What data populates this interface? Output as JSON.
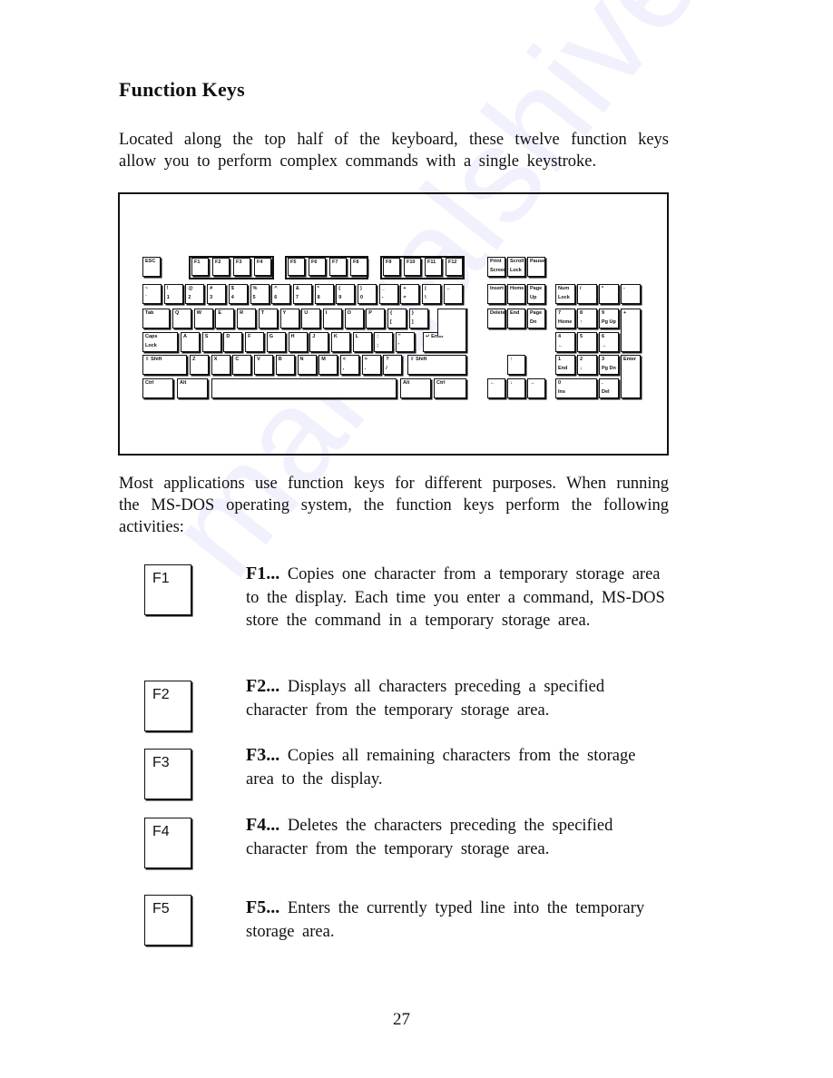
{
  "page": {
    "title": "Function Keys",
    "intro": "Located along the top half of the keyboard, these twelve function keys allow you to perform complex commands with a single keystroke.",
    "usage": "Most applications use function keys for different purposes. When running the MS-DOS operating system, the function keys perform the following activities:",
    "page_number": "27",
    "watermark": "manualshive.com"
  },
  "keyboard": {
    "rows": {
      "function": [
        "ESC",
        "F1",
        "F2",
        "F3",
        "F4",
        "F5",
        "F6",
        "F7",
        "F8",
        "F9",
        "F10",
        "F11",
        "F12"
      ],
      "number": [
        [
          "~",
          "`"
        ],
        [
          "!",
          "1"
        ],
        [
          "@",
          "2"
        ],
        [
          "#",
          "3"
        ],
        [
          "$",
          "4"
        ],
        [
          "%",
          "5"
        ],
        [
          "^",
          "6"
        ],
        [
          "&",
          "7"
        ],
        [
          "*",
          "8"
        ],
        [
          "(",
          "9"
        ],
        [
          ")",
          "0"
        ],
        [
          "_",
          "-"
        ],
        [
          "+",
          "="
        ],
        [
          "|",
          "\\"
        ],
        [
          "←",
          ""
        ]
      ],
      "qwerty": [
        "Tab",
        "Q",
        "W",
        "E",
        "R",
        "T",
        "Y",
        "U",
        "I",
        "O",
        "P",
        [
          "{",
          "["
        ],
        [
          "}",
          "]"
        ]
      ],
      "home": [
        "Caps Lock",
        "A",
        "S",
        "D",
        "F",
        "G",
        "H",
        "J",
        "K",
        "L",
        [
          ":",
          ";"
        ],
        [
          "\"",
          "'"
        ],
        "↵ Enter"
      ],
      "shift": [
        "⇧ Shift",
        "Z",
        "X",
        "C",
        "V",
        "B",
        "N",
        "M",
        [
          "<",
          ","
        ],
        [
          ">",
          "."
        ],
        [
          "?",
          "/"
        ],
        "⇧ Shift"
      ],
      "bottom": [
        "Ctrl",
        "Alt",
        "",
        "Alt",
        "Ctrl"
      ]
    },
    "system": [
      "Print Screen",
      "Scroll Lock",
      "Pause"
    ],
    "edit": [
      "Insert",
      "Home",
      "Page Up",
      "Delete",
      "End",
      "Page Dn"
    ],
    "arrows": [
      "↑",
      "←",
      "↓",
      "→"
    ],
    "numpad": [
      [
        "Num",
        "Lock"
      ],
      [
        "/",
        ""
      ],
      [
        "*",
        ""
      ],
      [
        "-",
        ""
      ],
      [
        "7",
        "Home"
      ],
      [
        "8",
        "↑"
      ],
      [
        "9",
        "Pg Up"
      ],
      [
        "+",
        ""
      ],
      [
        "4",
        "←"
      ],
      [
        "5",
        ""
      ],
      [
        "6",
        "→"
      ],
      [
        "1",
        "End"
      ],
      [
        "2",
        "↓"
      ],
      [
        "3",
        "Pg Dn"
      ],
      [
        "Enter",
        ""
      ],
      [
        "0",
        "Ins"
      ],
      [
        ".",
        "Del"
      ]
    ]
  },
  "function_keys": [
    {
      "key": "F1",
      "label": "F1...",
      "description": "Copies one character from a temporary storage area to the display. Each time you enter a command, MS-DOS store the command in a temporary storage area."
    },
    {
      "key": "F2",
      "label": "F2...",
      "description": "Displays all characters preceding a specified character from the temporary storage area."
    },
    {
      "key": "F3",
      "label": "F3...",
      "description": "Copies all remaining characters from the storage area to the display."
    },
    {
      "key": "F4",
      "label": "F4...",
      "description": "Deletes the characters preceding the specified character from the temporary storage area."
    },
    {
      "key": "F5",
      "label": "F5...",
      "description": "Enters the currently typed line into the temporary storage area."
    }
  ]
}
